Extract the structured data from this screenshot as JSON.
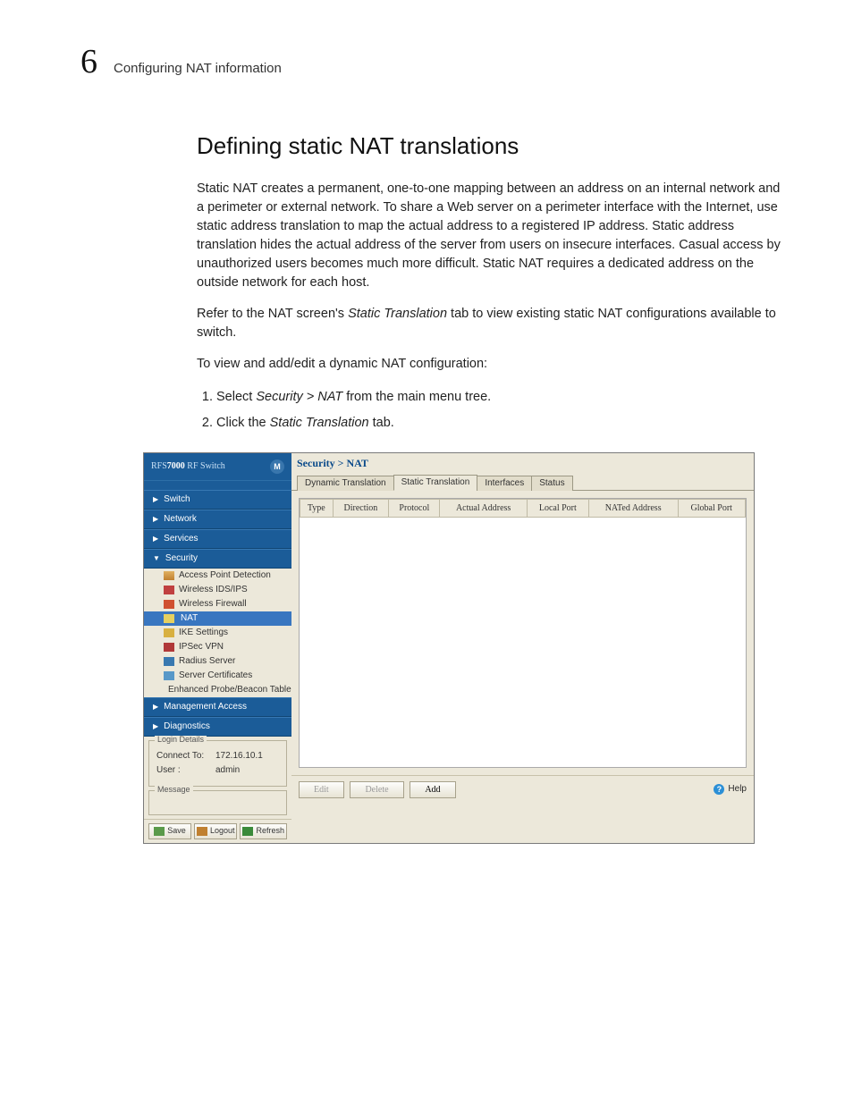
{
  "header": {
    "chapter_number": "6",
    "chapter_title": "Configuring NAT information"
  },
  "section": {
    "heading": "Defining static NAT translations",
    "p1": "Static NAT creates a permanent, one-to-one mapping between an address on an internal network and a perimeter or external network. To share a Web server on a perimeter interface with the Internet, use static address translation to map the actual address to a registered IP address. Static address translation hides the actual address of the server from users on insecure interfaces. Casual access by unauthorized users becomes much more difficult. Static NAT requires a dedicated address on the outside network for each host.",
    "p2_a": "Refer to the NAT screen's ",
    "p2_i": "Static Translation",
    "p2_b": " tab to view existing static NAT configurations available to switch.",
    "p3": "To view and add/edit a dynamic NAT configuration:",
    "steps": {
      "s1_a": "Select ",
      "s1_i": "Security > NAT",
      "s1_b": " from the main menu tree.",
      "s2_a": "Click the ",
      "s2_i": "Static Translation",
      "s2_b": " tab."
    }
  },
  "app": {
    "brand_prefix": "RFS",
    "brand_bold": "7000",
    "brand_suffix": " RF Switch",
    "logo_letter": "M",
    "menu": {
      "switch": "Switch",
      "network": "Network",
      "services": "Services",
      "security": "Security",
      "mgmt": "Management Access",
      "diag": "Diagnostics"
    },
    "security_items": {
      "ap": "Access Point Detection",
      "ids": "Wireless IDS/IPS",
      "fw": "Wireless Firewall",
      "nat": "NAT",
      "ike": "IKE Settings",
      "vpn": "IPSec VPN",
      "rad": "Radius Server",
      "cert": "Server Certificates",
      "probe": "Enhanced Probe/Beacon Table"
    },
    "login": {
      "legend": "Login Details",
      "connect_k": "Connect To:",
      "connect_v": "172.16.10.1",
      "user_k": "User :",
      "user_v": "admin"
    },
    "message_legend": "Message",
    "sb_buttons": {
      "save": "Save",
      "logout": "Logout",
      "refresh": "Refresh"
    },
    "breadcrumb": "Security > NAT",
    "tabs": {
      "dyn": "Dynamic Translation",
      "stat": "Static Translation",
      "if": "Interfaces",
      "status": "Status"
    },
    "columns": {
      "type": "Type",
      "direction": "Direction",
      "protocol": "Protocol",
      "actual": "Actual Address",
      "lport": "Local Port",
      "nated": "NATed Address",
      "gport": "Global Port"
    },
    "footer_buttons": {
      "edit": "Edit",
      "delete": "Delete",
      "add": "Add",
      "help": "Help"
    }
  }
}
